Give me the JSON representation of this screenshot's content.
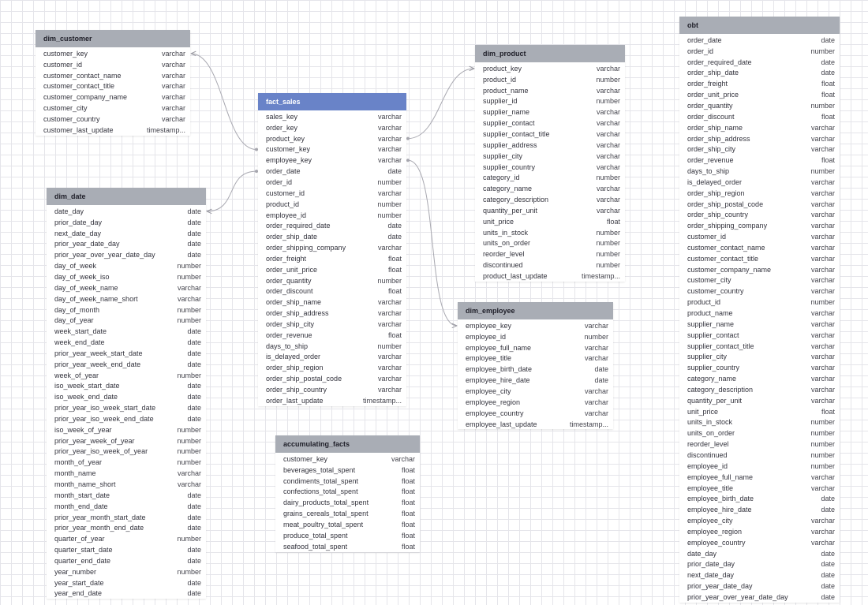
{
  "tables": [
    {
      "id": "dim_customer",
      "name": "dim_customer",
      "columns": [
        [
          "customer_key",
          "varchar"
        ],
        [
          "customer_id",
          "varchar"
        ],
        [
          "customer_contact_name",
          "varchar"
        ],
        [
          "customer_contact_title",
          "varchar"
        ],
        [
          "customer_company_name",
          "varchar"
        ],
        [
          "customer_city",
          "varchar"
        ],
        [
          "customer_country",
          "varchar"
        ],
        [
          "customer_last_update",
          "timestamp..."
        ]
      ]
    },
    {
      "id": "fact_sales",
      "name": "fact_sales",
      "highlight": true,
      "columns": [
        [
          "sales_key",
          "varchar"
        ],
        [
          "order_key",
          "varchar"
        ],
        [
          "product_key",
          "varchar"
        ],
        [
          "customer_key",
          "varchar"
        ],
        [
          "employee_key",
          "varchar"
        ],
        [
          "order_date",
          "date"
        ],
        [
          "order_id",
          "number"
        ],
        [
          "customer_id",
          "varchar"
        ],
        [
          "product_id",
          "number"
        ],
        [
          "employee_id",
          "number"
        ],
        [
          "order_required_date",
          "date"
        ],
        [
          "order_ship_date",
          "date"
        ],
        [
          "order_shipping_company",
          "varchar"
        ],
        [
          "order_freight",
          "float"
        ],
        [
          "order_unit_price",
          "float"
        ],
        [
          "order_quantity",
          "number"
        ],
        [
          "order_discount",
          "float"
        ],
        [
          "order_ship_name",
          "varchar"
        ],
        [
          "order_ship_address",
          "varchar"
        ],
        [
          "order_ship_city",
          "varchar"
        ],
        [
          "order_revenue",
          "float"
        ],
        [
          "days_to_ship",
          "number"
        ],
        [
          "is_delayed_order",
          "varchar"
        ],
        [
          "order_ship_region",
          "varchar"
        ],
        [
          "order_ship_postal_code",
          "varchar"
        ],
        [
          "order_ship_country",
          "varchar"
        ],
        [
          "order_last_update",
          "timestamp..."
        ]
      ]
    },
    {
      "id": "dim_product",
      "name": "dim_product",
      "columns": [
        [
          "product_key",
          "varchar"
        ],
        [
          "product_id",
          "number"
        ],
        [
          "product_name",
          "varchar"
        ],
        [
          "supplier_id",
          "number"
        ],
        [
          "supplier_name",
          "varchar"
        ],
        [
          "supplier_contact",
          "varchar"
        ],
        [
          "supplier_contact_title",
          "varchar"
        ],
        [
          "supplier_address",
          "varchar"
        ],
        [
          "supplier_city",
          "varchar"
        ],
        [
          "supplier_country",
          "varchar"
        ],
        [
          "category_id",
          "number"
        ],
        [
          "category_name",
          "varchar"
        ],
        [
          "category_description",
          "varchar"
        ],
        [
          "quantity_per_unit",
          "varchar"
        ],
        [
          "unit_price",
          "float"
        ],
        [
          "units_in_stock",
          "number"
        ],
        [
          "units_on_order",
          "number"
        ],
        [
          "reorder_level",
          "number"
        ],
        [
          "discontinued",
          "number"
        ],
        [
          "product_last_update",
          "timestamp..."
        ]
      ]
    },
    {
      "id": "dim_date",
      "name": "dim_date",
      "columns": [
        [
          "date_day",
          "date"
        ],
        [
          "prior_date_day",
          "date"
        ],
        [
          "next_date_day",
          "date"
        ],
        [
          "prior_year_date_day",
          "date"
        ],
        [
          "prior_year_over_year_date_day",
          "date"
        ],
        [
          "day_of_week",
          "number"
        ],
        [
          "day_of_week_iso",
          "number"
        ],
        [
          "day_of_week_name",
          "varchar"
        ],
        [
          "day_of_week_name_short",
          "varchar"
        ],
        [
          "day_of_month",
          "number"
        ],
        [
          "day_of_year",
          "number"
        ],
        [
          "week_start_date",
          "date"
        ],
        [
          "week_end_date",
          "date"
        ],
        [
          "prior_year_week_start_date",
          "date"
        ],
        [
          "prior_year_week_end_date",
          "date"
        ],
        [
          "week_of_year",
          "number"
        ],
        [
          "iso_week_start_date",
          "date"
        ],
        [
          "iso_week_end_date",
          "date"
        ],
        [
          "prior_year_iso_week_start_date",
          "date"
        ],
        [
          "prior_year_iso_week_end_date",
          "date"
        ],
        [
          "iso_week_of_year",
          "number"
        ],
        [
          "prior_year_week_of_year",
          "number"
        ],
        [
          "prior_year_iso_week_of_year",
          "number"
        ],
        [
          "month_of_year",
          "number"
        ],
        [
          "month_name",
          "varchar"
        ],
        [
          "month_name_short",
          "varchar"
        ],
        [
          "month_start_date",
          "date"
        ],
        [
          "month_end_date",
          "date"
        ],
        [
          "prior_year_month_start_date",
          "date"
        ],
        [
          "prior_year_month_end_date",
          "date"
        ],
        [
          "quarter_of_year",
          "number"
        ],
        [
          "quarter_start_date",
          "date"
        ],
        [
          "quarter_end_date",
          "date"
        ],
        [
          "year_number",
          "number"
        ],
        [
          "year_start_date",
          "date"
        ],
        [
          "year_end_date",
          "date"
        ]
      ]
    },
    {
      "id": "dim_employee",
      "name": "dim_employee",
      "columns": [
        [
          "employee_key",
          "varchar"
        ],
        [
          "employee_id",
          "number"
        ],
        [
          "employee_full_name",
          "varchar"
        ],
        [
          "employee_title",
          "varchar"
        ],
        [
          "employee_birth_date",
          "date"
        ],
        [
          "employee_hire_date",
          "date"
        ],
        [
          "employee_city",
          "varchar"
        ],
        [
          "employee_region",
          "varchar"
        ],
        [
          "employee_country",
          "varchar"
        ],
        [
          "employee_last_update",
          "timestamp..."
        ]
      ]
    },
    {
      "id": "accumulating_facts",
      "name": "accumulating_facts",
      "columns": [
        [
          "customer_key",
          "varchar"
        ],
        [
          "beverages_total_spent",
          "float"
        ],
        [
          "condiments_total_spent",
          "float"
        ],
        [
          "confections_total_spent",
          "float"
        ],
        [
          "dairy_products_total_spent",
          "float"
        ],
        [
          "grains_cereals_total_spent",
          "float"
        ],
        [
          "meat_poultry_total_spent",
          "float"
        ],
        [
          "produce_total_spent",
          "float"
        ],
        [
          "seafood_total_spent",
          "float"
        ]
      ]
    },
    {
      "id": "obt",
      "name": "obt",
      "columns": [
        [
          "order_date",
          "date"
        ],
        [
          "order_id",
          "number"
        ],
        [
          "order_required_date",
          "date"
        ],
        [
          "order_ship_date",
          "date"
        ],
        [
          "order_freight",
          "float"
        ],
        [
          "order_unit_price",
          "float"
        ],
        [
          "order_quantity",
          "number"
        ],
        [
          "order_discount",
          "float"
        ],
        [
          "order_ship_name",
          "varchar"
        ],
        [
          "order_ship_address",
          "varchar"
        ],
        [
          "order_ship_city",
          "varchar"
        ],
        [
          "order_revenue",
          "float"
        ],
        [
          "days_to_ship",
          "number"
        ],
        [
          "is_delayed_order",
          "varchar"
        ],
        [
          "order_ship_region",
          "varchar"
        ],
        [
          "order_ship_postal_code",
          "varchar"
        ],
        [
          "order_ship_country",
          "varchar"
        ],
        [
          "order_shipping_company",
          "varchar"
        ],
        [
          "customer_id",
          "varchar"
        ],
        [
          "customer_contact_name",
          "varchar"
        ],
        [
          "customer_contact_title",
          "varchar"
        ],
        [
          "customer_company_name",
          "varchar"
        ],
        [
          "customer_city",
          "varchar"
        ],
        [
          "customer_country",
          "varchar"
        ],
        [
          "product_id",
          "number"
        ],
        [
          "product_name",
          "varchar"
        ],
        [
          "supplier_name",
          "varchar"
        ],
        [
          "supplier_contact",
          "varchar"
        ],
        [
          "supplier_contact_title",
          "varchar"
        ],
        [
          "supplier_city",
          "varchar"
        ],
        [
          "supplier_country",
          "varchar"
        ],
        [
          "category_name",
          "varchar"
        ],
        [
          "category_description",
          "varchar"
        ],
        [
          "quantity_per_unit",
          "varchar"
        ],
        [
          "unit_price",
          "float"
        ],
        [
          "units_in_stock",
          "number"
        ],
        [
          "units_on_order",
          "number"
        ],
        [
          "reorder_level",
          "number"
        ],
        [
          "discontinued",
          "number"
        ],
        [
          "employee_id",
          "number"
        ],
        [
          "employee_full_name",
          "varchar"
        ],
        [
          "employee_title",
          "varchar"
        ],
        [
          "employee_birth_date",
          "date"
        ],
        [
          "employee_hire_date",
          "date"
        ],
        [
          "employee_city",
          "varchar"
        ],
        [
          "employee_region",
          "varchar"
        ],
        [
          "employee_country",
          "varchar"
        ],
        [
          "date_day",
          "date"
        ],
        [
          "prior_date_day",
          "date"
        ],
        [
          "next_date_day",
          "date"
        ],
        [
          "prior_year_date_day",
          "date"
        ],
        [
          "prior_year_over_year_date_day",
          "date"
        ]
      ]
    }
  ],
  "relationships": [
    {
      "from_table": "fact_sales",
      "from_column": "customer_key",
      "to_table": "dim_customer",
      "to_column": "customer_key"
    },
    {
      "from_table": "fact_sales",
      "from_column": "product_key",
      "to_table": "dim_product",
      "to_column": "product_key"
    },
    {
      "from_table": "fact_sales",
      "from_column": "order_date",
      "to_table": "dim_date",
      "to_column": "date_day"
    },
    {
      "from_table": "fact_sales",
      "from_column": "employee_key",
      "to_table": "dim_employee",
      "to_column": "employee_key"
    }
  ]
}
